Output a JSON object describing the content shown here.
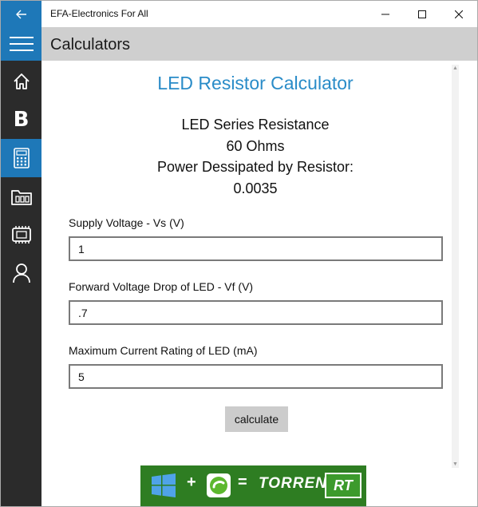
{
  "window": {
    "title": "EFA-Electronics For All",
    "controls": [
      "minimize-icon",
      "maximize-icon",
      "close-icon"
    ]
  },
  "header": {
    "page_title": "Calculators"
  },
  "sidebar": {
    "items": [
      {
        "icon": "home-icon",
        "active": false
      },
      {
        "icon": "bold-b-icon",
        "label": "B",
        "active": false
      },
      {
        "icon": "calculator-icon",
        "active": true
      },
      {
        "icon": "folder-icon",
        "active": false
      },
      {
        "icon": "chip-icon",
        "active": false
      },
      {
        "icon": "person-icon",
        "active": false
      }
    ]
  },
  "main": {
    "title": "LED Resistor Calculator",
    "result_line1": "LED Series Resistance",
    "result_line2": "60 Ohms",
    "result_line3": "Power Dessipated by Resistor:",
    "result_line4": "0.0035",
    "fields": [
      {
        "label": "Supply Voltage - Vs (V)",
        "value": "1"
      },
      {
        "label": "Forward Voltage Drop of LED - Vf (V)",
        "value": ".7"
      },
      {
        "label": "Maximum Current Rating of LED (mA)",
        "value": "5"
      }
    ],
    "button_label": "calculate"
  },
  "ad": {
    "plus": "+",
    "equals": "=",
    "word": "TORRENT",
    "badge": "RT"
  },
  "colors": {
    "accent": "#1e78b8",
    "sidebar": "#2b2b2b",
    "header": "#cfcfcf",
    "title_text": "#2a8cc8",
    "ad_bg": "#2e7d22"
  }
}
